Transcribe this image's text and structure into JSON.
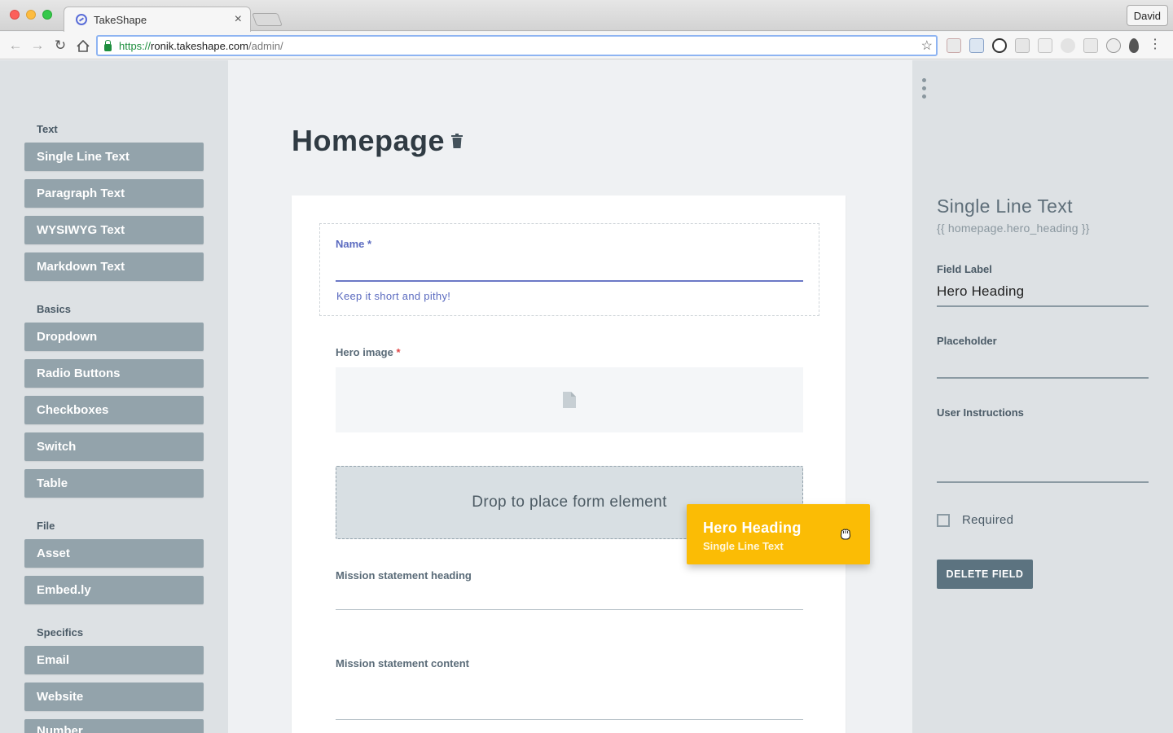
{
  "browser": {
    "tab_title": "TakeShape",
    "tab_close": "×",
    "profile_name": "David",
    "url_scheme": "https://",
    "url_host": "ronik.takeshape.com",
    "url_path": "/admin/"
  },
  "palette": {
    "groups": [
      {
        "title": "Text",
        "items": [
          "Single Line Text",
          "Paragraph Text",
          "WYSIWYG Text",
          "Markdown Text"
        ]
      },
      {
        "title": "Basics",
        "items": [
          "Dropdown",
          "Radio Buttons",
          "Checkboxes",
          "Switch",
          "Table"
        ]
      },
      {
        "title": "File",
        "items": [
          "Asset",
          "Embed.ly"
        ]
      },
      {
        "title": "Specifics",
        "items": [
          "Email",
          "Website",
          "Number"
        ]
      }
    ]
  },
  "editor": {
    "page_title": "Homepage",
    "fields": {
      "name_label": "Name",
      "name_required": "*",
      "name_help": "Keep it short and pithy!",
      "hero_image_label": "Hero image",
      "hero_image_required": "*",
      "drop_zone_text": "Drop to place form element",
      "mission_heading_label": "Mission statement heading",
      "mission_content_label": "Mission statement content"
    },
    "drag_chip": {
      "title": "Hero Heading",
      "subtitle": "Single Line Text"
    }
  },
  "inspector": {
    "title": "Single Line Text",
    "handle": "{{ homepage.hero_heading }}",
    "field_label_label": "Field Label",
    "field_label_value": "Hero Heading",
    "placeholder_label": "Placeholder",
    "placeholder_value": "",
    "instructions_label": "User Instructions",
    "required_label": "Required",
    "required_checked": false,
    "delete_button": "DELETE FIELD"
  },
  "colors": {
    "palette_button": "#93a3ab",
    "drag_chip": "#fbbc05",
    "accent_blue": "#5b6bc0",
    "delete_button": "#5c7380"
  }
}
